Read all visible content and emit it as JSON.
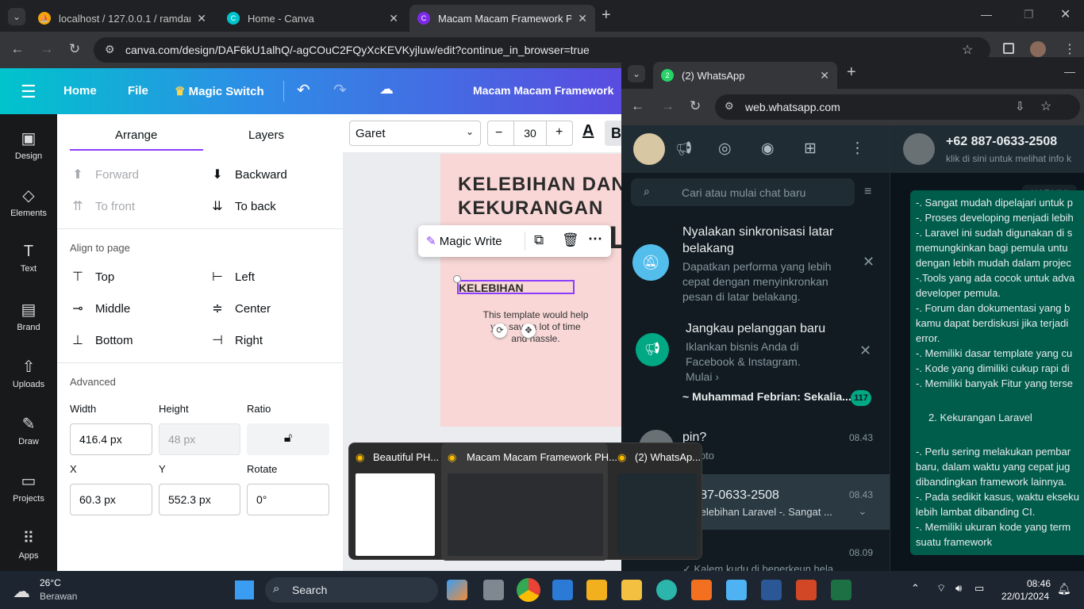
{
  "browser": {
    "tabs": [
      {
        "title": "localhost / 127.0.0.1 / ramdank"
      },
      {
        "title": "Home - Canva"
      },
      {
        "title": "Macam Macam Framework PHP"
      }
    ],
    "url": "canva.com/design/DAF6kU1alhQ/-agCOuC2FQyXcKEVKyjluw/edit?continue_in_browser=true"
  },
  "canva": {
    "menu": {
      "home": "Home",
      "file": "File",
      "magic": "Magic Switch"
    },
    "doc_title": "Macam Macam Framework",
    "rail": [
      "Design",
      "Elements",
      "Text",
      "Brand",
      "Uploads",
      "Draw",
      "Projects",
      "Apps"
    ],
    "panel": {
      "tab_arrange": "Arrange",
      "tab_layers": "Layers",
      "forward": "Forward",
      "backward": "Backward",
      "to_front": "To front",
      "to_back": "To back",
      "align_title": "Align to page",
      "top": "Top",
      "left": "Left",
      "middle": "Middle",
      "center": "Center",
      "bottom": "Bottom",
      "right": "Right",
      "advanced": "Advanced",
      "width_label": "Width",
      "height_label": "Height",
      "ratio_label": "Ratio",
      "width": "416.4 px",
      "height": "48 px",
      "x_label": "X",
      "y_label": "Y",
      "rotate_label": "Rotate",
      "x": "60.3 px",
      "y": "552.3 px",
      "rotate": "0°"
    },
    "font": "Garet",
    "font_size": "30",
    "bold": "B",
    "color_label": "A",
    "canvas": {
      "heading": "KELEBIHAN DAN KEKURANGAN",
      "selected": "KELEBIHAN",
      "template": "This template would help you save a lot of time and hassle.",
      "magic_write": "Magic Write",
      "big_letter": "L"
    }
  },
  "whatsapp": {
    "tab": "(2) WhatsApp",
    "badge": "2",
    "url": "web.whatsapp.com",
    "search": "Cari atau mulai chat baru",
    "banner1": {
      "title": "Nyalakan sinkronisasi latar belakang",
      "text": "Dapatkan performa yang lebih cepat dengan menyinkronkan pesan di latar belakang."
    },
    "banner2": {
      "title": "Jangkau pelanggan baru",
      "text": "Iklankan bisnis Anda di Facebook & Instagram.",
      "link": "Mulai ›"
    },
    "chats": [
      {
        "name": "~ Muhammad Febrian: Sekalia...",
        "badge": "117"
      },
      {
        "name": "pin?",
        "preview": "Foto",
        "time": "08.43"
      },
      {
        "name": "2 887-0633-2508",
        "preview": "Kelebihan Laravel  -. Sangat ...",
        "time": "08.43"
      },
      {
        "name": "ei",
        "preview": "✓ Kalem kudu di benerkeun hela",
        "time": "08.09"
      }
    ],
    "contact": "+62 887-0633-2508",
    "contact_sub": "klik di sini untuk melihat info k",
    "day": "HARI INI",
    "messages": [
      "-. Sangat mudah dipelajari untuk p",
      "-. Proses developing menjadi lebih",
      "-. Laravel ini sudah digunakan di s",
      "memungkinkan bagi pemula untu",
      "dengan lebih mudah dalam projec",
      "-.Tools yang ada cocok untuk adva",
      "developer pemula.",
      "-. Forum dan dokumentasi yang b",
      "kamu dapat berdiskusi jika terjadi",
      "error.",
      "-. Memiliki dasar template yang cu",
      "-. Kode yang dimiliki cukup rapi di",
      "-. Memiliki banyak Fitur yang terse",
      "2. Kekurangan Laravel",
      "-. Perlu sering melakukan pembar",
      "baru, dalam waktu yang cepat jug",
      "dibandingkan framework lainnya.",
      "-. Pada sedikit kasus, waktu ekseku",
      "lebih lambat dibanding CI.",
      "-. Memiliki ukuran kode yang term",
      "suatu framework"
    ]
  },
  "switcher": [
    {
      "title": "Beautiful PH..."
    },
    {
      "title": "Macam Macam Framework PH..."
    },
    {
      "title": "(2) WhatsAp..."
    }
  ],
  "taskbar": {
    "temp": "26°C",
    "weather": "Berawan",
    "search": "Search",
    "time": "08:46",
    "date": "22/01/2024"
  }
}
